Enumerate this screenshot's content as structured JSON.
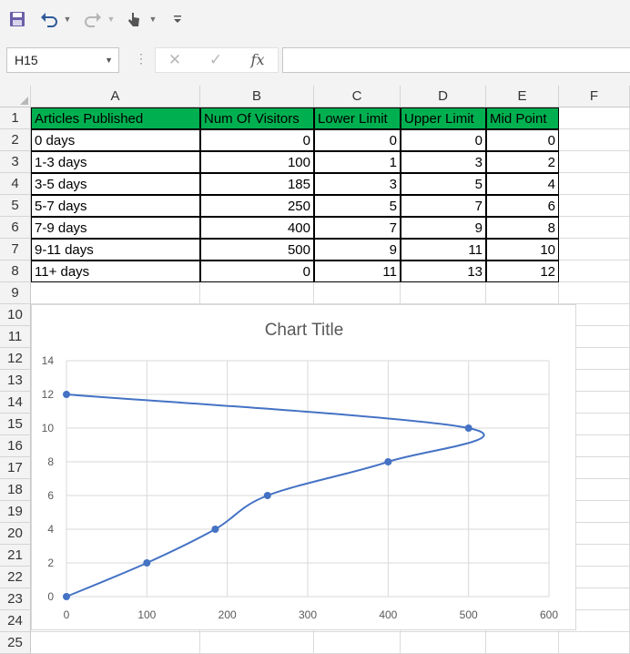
{
  "toolbar": {
    "icons": [
      "save-icon",
      "undo-icon",
      "redo-icon",
      "touch-mode-icon",
      "customize-qat-icon"
    ]
  },
  "formula_bar": {
    "name_box": "H15",
    "cancel_glyph": "✕",
    "enter_glyph": "✓",
    "fx_glyph": "fx",
    "formula": ""
  },
  "columns": [
    "A",
    "B",
    "C",
    "D",
    "E",
    "F"
  ],
  "rows": [
    "1",
    "2",
    "3",
    "4",
    "5",
    "6",
    "7",
    "8",
    "9",
    "10",
    "11",
    "12",
    "13",
    "14",
    "15",
    "16",
    "17",
    "18",
    "19",
    "20",
    "21",
    "22",
    "23",
    "24",
    "25"
  ],
  "table": {
    "headers": [
      "Articles Published",
      "Num Of Visitors",
      "Lower Limit",
      "Upper Limit",
      "Mid Point"
    ],
    "data": [
      [
        "0 days",
        "0",
        "0",
        "0",
        "0"
      ],
      [
        "1-3 days",
        "100",
        "1",
        "3",
        "2"
      ],
      [
        "3-5 days",
        "185",
        "3",
        "5",
        "4"
      ],
      [
        "5-7 days",
        "250",
        "5",
        "7",
        "6"
      ],
      [
        "7-9 days",
        "400",
        "7",
        "9",
        "8"
      ],
      [
        "9-11 days",
        "500",
        "9",
        "11",
        "10"
      ],
      [
        "11+ days",
        "0",
        "11",
        "13",
        "12"
      ]
    ]
  },
  "chart_data": {
    "type": "scatter",
    "title": "Chart Title",
    "xlabel": "",
    "ylabel": "",
    "xlim": [
      0,
      600
    ],
    "ylim": [
      0,
      14
    ],
    "xticks": [
      0,
      100,
      200,
      300,
      400,
      500,
      600
    ],
    "yticks": [
      0,
      2,
      4,
      6,
      8,
      10,
      12,
      14
    ],
    "grid": true,
    "smooth": true,
    "series_color": "#4472c4",
    "series": [
      {
        "x": [
          0,
          100,
          185,
          250,
          400,
          500,
          0
        ],
        "y": [
          0,
          2,
          4,
          6,
          8,
          10,
          12
        ]
      }
    ]
  }
}
